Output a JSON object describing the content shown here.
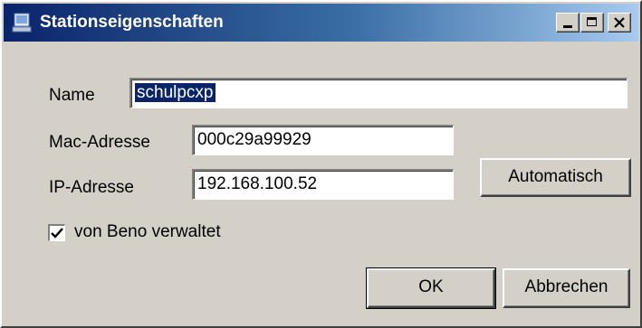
{
  "window": {
    "title": "Stationseigenschaften",
    "controls": {
      "minimize": "minimize",
      "maximize": "maximize",
      "close": "close"
    }
  },
  "form": {
    "name_label": "Name",
    "name_value": "schulpcxp",
    "mac_label": "Mac-Adresse",
    "mac_value": "000c29a99929",
    "ip_label": "IP-Adresse",
    "ip_value": "192.168.100.52",
    "auto_button": "Automatisch",
    "managed_label": "von Beno verwaltet",
    "managed_checked": true
  },
  "actions": {
    "ok": "OK",
    "cancel": "Abbrechen"
  },
  "colors": {
    "face": "#d4d0c8",
    "title_start": "#0a246a",
    "title_end": "#a6caf0",
    "selection": "#0a246a"
  }
}
